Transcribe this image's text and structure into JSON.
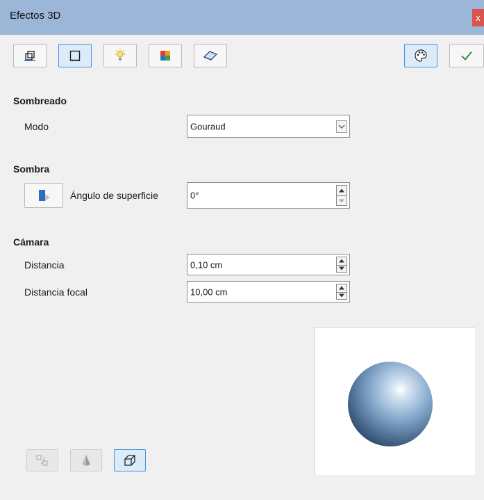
{
  "window": {
    "title": "Efectos 3D",
    "close_label": "x"
  },
  "toolbar": {
    "left_buttons": [
      {
        "icon": "geometry-icon",
        "active": false
      },
      {
        "icon": "shading-icon",
        "active": true
      },
      {
        "icon": "illumination-icon",
        "active": false
      },
      {
        "icon": "textures-icon",
        "active": false
      },
      {
        "icon": "material-icon",
        "active": false
      }
    ],
    "right_buttons": [
      {
        "icon": "palette-icon",
        "active": true
      },
      {
        "icon": "checkmark-icon",
        "active": false
      }
    ]
  },
  "sombreado": {
    "heading": "Sombreado",
    "modo_label": "Modo",
    "modo_value": "Gouraud"
  },
  "sombra": {
    "heading": "Sombra",
    "angle_label": "Ángulo de superficie",
    "angle_value": "0°"
  },
  "camara": {
    "heading": "Cámara",
    "distancia_label": "Distancia",
    "distancia_value": "0,10 cm",
    "focal_label": "Distancia focal",
    "focal_value": "10,00 cm"
  },
  "bottom_buttons": [
    {
      "icon": "convert-3d-icon",
      "active": false
    },
    {
      "icon": "lathe-object-icon",
      "active": false
    },
    {
      "icon": "perspective-icon",
      "active": true
    }
  ],
  "colors": {
    "titlebar": "#9bb6d7",
    "active_border": "#4a90d9",
    "active_bg": "#dcebfa",
    "close": "#d9534f"
  }
}
